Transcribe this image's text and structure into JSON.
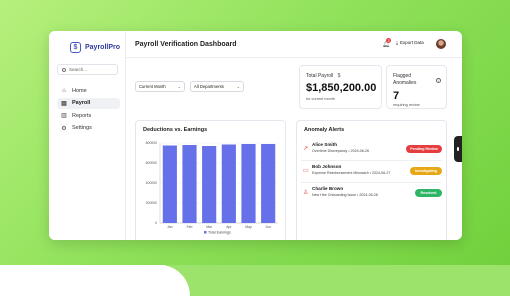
{
  "brand": {
    "name": "PayrollPro",
    "logo_glyph": "$"
  },
  "sidebar": {
    "search_placeholder": "Search...",
    "items": [
      {
        "label": "Home",
        "icon": "home-icon",
        "active": false
      },
      {
        "label": "Payroll",
        "icon": "wallet-icon",
        "active": true
      },
      {
        "label": "Reports",
        "icon": "bar-chart-icon",
        "active": false
      },
      {
        "label": "Settings",
        "icon": "gear-icon",
        "active": false
      }
    ]
  },
  "header": {
    "title": "Payroll Verification Dashboard",
    "notification_count": "3",
    "export_label": "Export Data"
  },
  "filters": {
    "period": "Current Month",
    "department": "All Departments"
  },
  "stats": {
    "total_payroll": {
      "label": "Total Payroll",
      "currency_glyph": "$",
      "value": "$1,850,200.00",
      "sub": "for current month"
    },
    "flagged": {
      "label": "Flagged Anomalies",
      "value": "7",
      "sub": "requiring review"
    }
  },
  "deductions_card": {
    "title": "Deductions vs. Earnings"
  },
  "chart_data": {
    "type": "bar",
    "categories": [
      "Jan",
      "Feb",
      "Mar",
      "Apr",
      "May",
      "Jun"
    ],
    "series": [
      {
        "name": "Total Earnings",
        "values": [
          775000,
          780000,
          770000,
          785000,
          790000,
          790000
        ]
      }
    ],
    "ylim": [
      0,
      800000
    ],
    "yticks": [
      0,
      200000,
      400000,
      600000,
      800000
    ],
    "ytick_labels": [
      "0",
      "200000",
      "400000",
      "600000",
      "800000"
    ],
    "bar_color": "#6670e8",
    "legend": "bottom"
  },
  "alerts": {
    "title": "Anomaly Alerts",
    "items": [
      {
        "name": "Alice Smith",
        "detail": "Overtime Discrepancy • 2024-06-26",
        "status": "Pending Review",
        "status_color": "#e53e3e",
        "icon": "trend-up-icon"
      },
      {
        "name": "Bob Johnson",
        "detail": "Expense Reimbursement Mismatch • 2024-06-27",
        "status": "Investigating",
        "status_color": "#e6a817",
        "icon": "credit-card-icon"
      },
      {
        "name": "Charlie Brown",
        "detail": "New Hire Onboarding Issue • 2024-06-28",
        "status": "Resolved",
        "status_color": "#2fb566",
        "icon": "user-icon"
      }
    ]
  }
}
